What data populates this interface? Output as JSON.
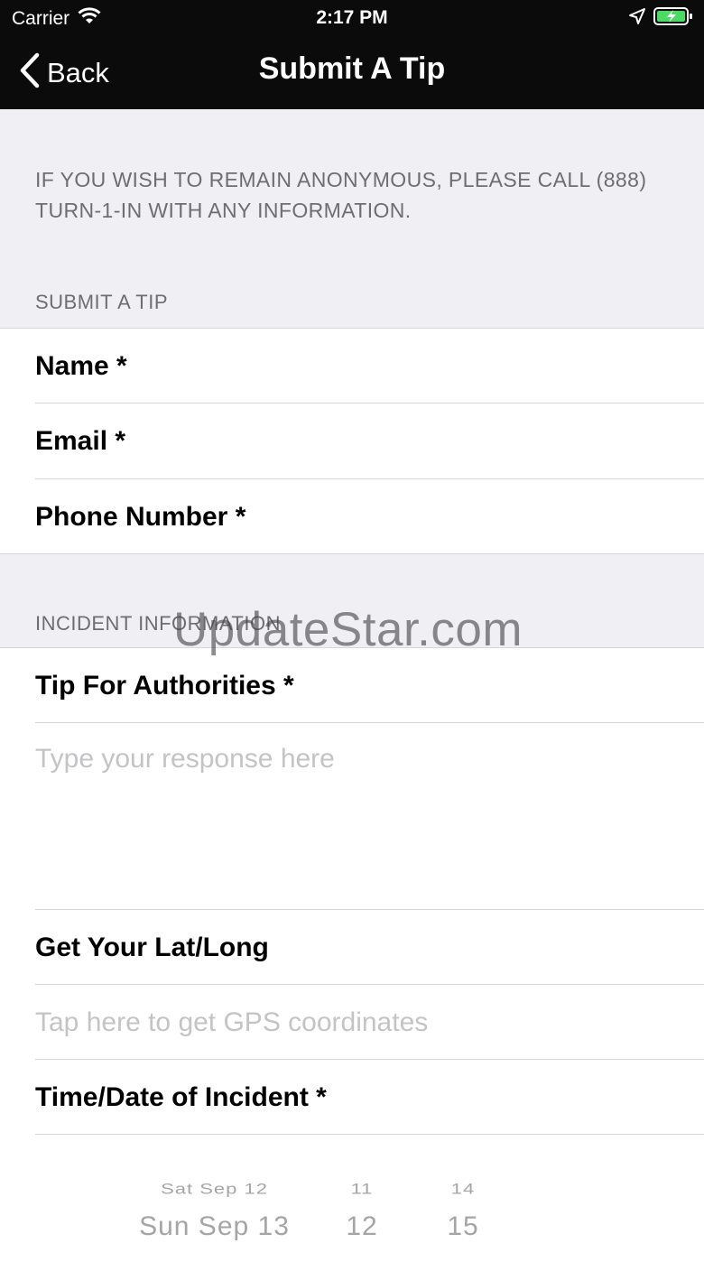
{
  "status_bar": {
    "carrier": "Carrier",
    "time": "2:17 PM",
    "icons": [
      "wifi-icon",
      "location-arrow-icon",
      "battery-charging-icon"
    ]
  },
  "nav": {
    "back_label": "Back",
    "title": "Submit A Tip"
  },
  "notice": "IF YOU WISH TO REMAIN ANONYMOUS, PLEASE CALL (888) TURN-1-IN WITH ANY INFORMATION.",
  "section_submit": {
    "header": "SUBMIT A TIP",
    "fields": [
      {
        "label": "Name *"
      },
      {
        "label": "Email *"
      },
      {
        "label": "Phone Number *"
      }
    ]
  },
  "section_incident": {
    "header": "INCIDENT INFORMATION",
    "tip_label": "Tip For Authorities *",
    "tip_placeholder": "Type your response here",
    "latlong_label": "Get Your Lat/Long",
    "gps_placeholder": "Tap here to get GPS coordinates",
    "datetime_label": "Time/Date of Incident *"
  },
  "picker": {
    "date": {
      "prev": "Sat Sep 12",
      "selected": "Sun Sep 13"
    },
    "hour": {
      "prev": "11",
      "selected": "12"
    },
    "minute": {
      "prev": "14",
      "selected": "15"
    }
  },
  "watermark": "UpdateStar.com",
  "colors": {
    "nav_bg": "#0b0b0b",
    "page_bg": "#efeff4",
    "header_text": "#6d6d72",
    "placeholder": "#c4c4c7",
    "battery_green": "#4cd964"
  }
}
